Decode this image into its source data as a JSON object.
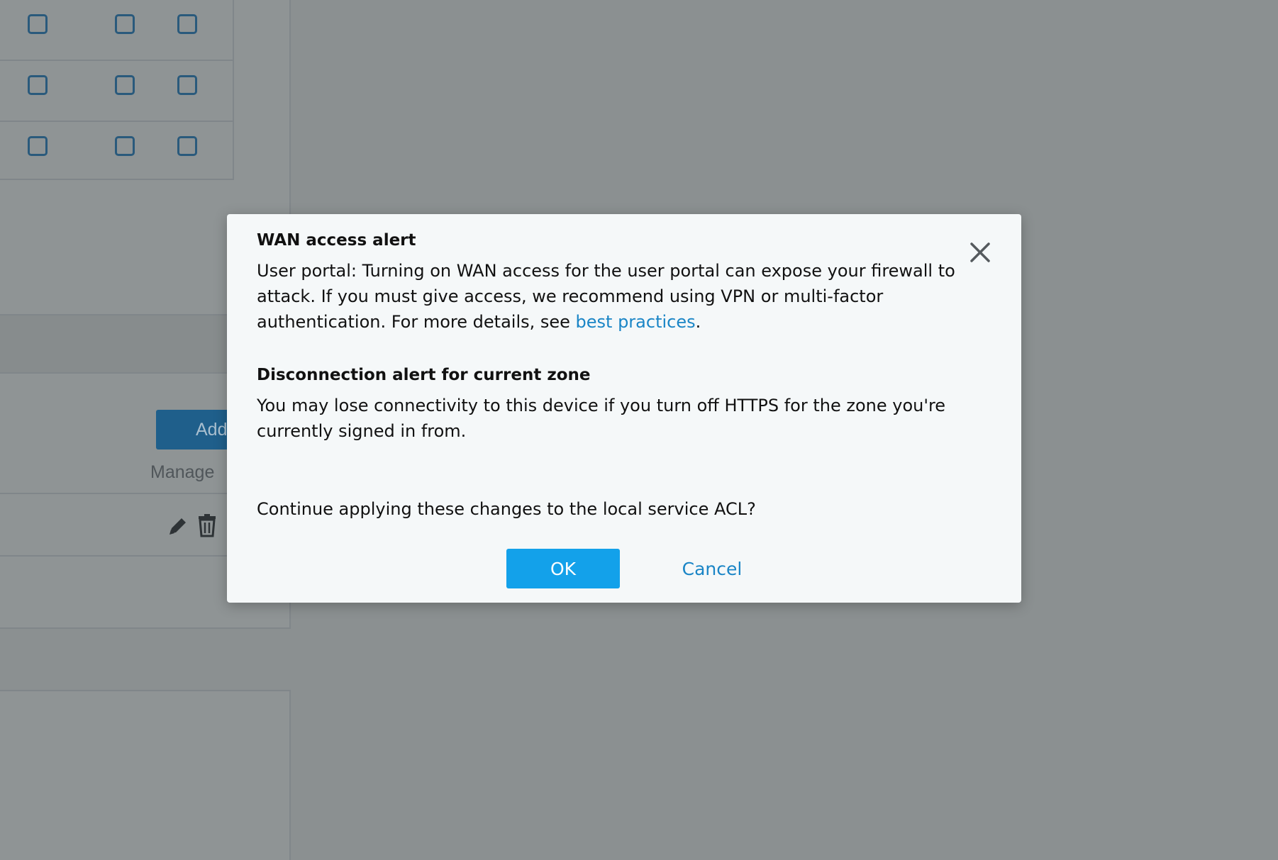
{
  "background": {
    "add_button_label": "Add",
    "manage_label": "Manage",
    "checkbox_rows": [
      [
        false,
        false,
        false
      ],
      [
        false,
        false,
        false
      ],
      [
        false,
        false,
        false
      ]
    ]
  },
  "modal": {
    "title": "WAN access alert",
    "wan_text_before_link": "User portal: Turning on WAN access for the user portal can expose your firewall to attack. If you must give access, we recommend using VPN or multi-factor authentication. For more details, see ",
    "wan_link": "best practices",
    "wan_text_after_link": ".",
    "disconnect_title": "Disconnection alert for current zone",
    "disconnect_text": "You may lose connectivity to this device if you turn off HTTPS for the zone you're currently signed in from.",
    "question": "Continue applying these changes to the local service ACL?",
    "ok_label": "OK",
    "cancel_label": "Cancel",
    "close_icon": "close-icon"
  },
  "colors": {
    "overlay": "#8b9091",
    "modal_bg": "#f5f8f9",
    "primary_button": "#13a1ea",
    "link": "#1a85c6",
    "checkbox_border": "#2a5a7c"
  }
}
